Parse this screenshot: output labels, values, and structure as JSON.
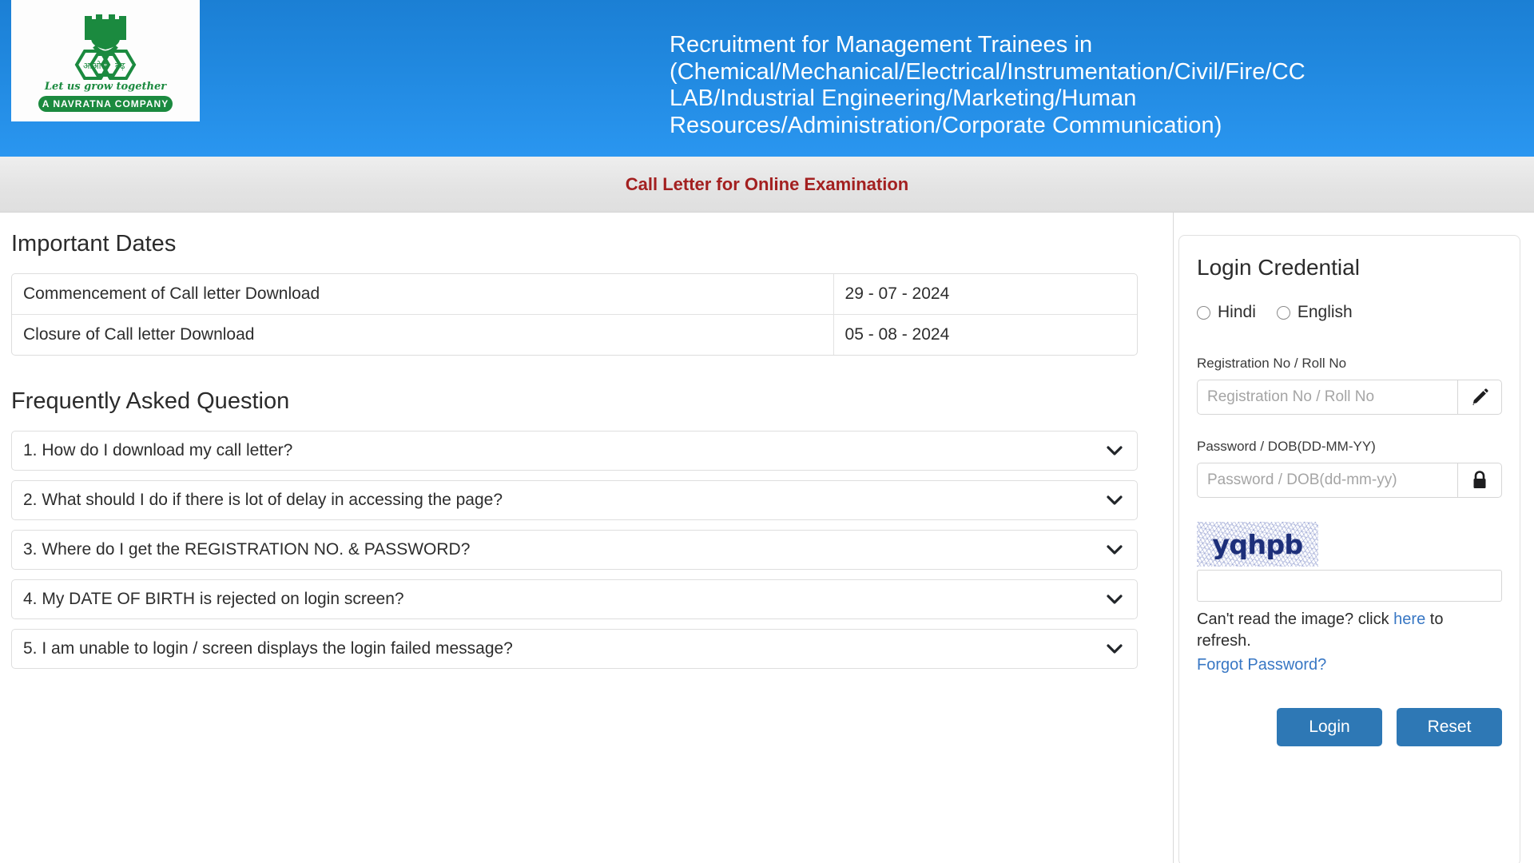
{
  "header": {
    "title": "Recruitment for Management Trainees in (Chemical/Mechanical/Electrical/Instrumentation/Civil/Fire/CC LAB/Industrial Engineering/Marketing/Human Resources/Administration/Corporate Communication)",
    "logo": {
      "hindi_left": "आओ",
      "hindi_center": "मी",
      "hindi_right": "बढ़",
      "tagline": "Let us grow together",
      "badge": "A NAVRATNA COMPANY"
    },
    "subtitle": "Call Letter for Online Examination",
    "colors": {
      "header_gradient_top": "#1b7fd4",
      "header_gradient_bottom": "#2a96f0",
      "subtitle_text": "#a32020",
      "logo_green": "#1b8a3f"
    }
  },
  "important_dates": {
    "heading": "Important Dates",
    "rows": [
      {
        "label": "Commencement of Call letter Download",
        "value": "29 - 07 - 2024"
      },
      {
        "label": "Closure of Call letter Download",
        "value": "05 - 08 - 2024"
      }
    ]
  },
  "faq": {
    "heading": "Frequently Asked Question",
    "items": [
      {
        "question": "1. How do I download my call letter?"
      },
      {
        "question": "2. What should I do if there is lot of delay in accessing the page?"
      },
      {
        "question": "3. Where do I get the REGISTRATION NO. & PASSWORD?"
      },
      {
        "question": "4. My DATE OF BIRTH is rejected on login screen?"
      },
      {
        "question": "5. I am unable to login / screen displays the login failed message?"
      }
    ]
  },
  "login": {
    "title": "Login Credential",
    "language_options": [
      {
        "label": "Hindi",
        "selected": false
      },
      {
        "label": "English",
        "selected": false
      }
    ],
    "registration": {
      "label": "Registration No / Roll No",
      "placeholder": "Registration No / Roll No",
      "value": "",
      "addon_icon": "pencil-icon"
    },
    "password": {
      "label": "Password / DOB(DD-MM-YY)",
      "placeholder": "Password / DOB(dd-mm-yy)",
      "value": "",
      "addon_icon": "lock-icon"
    },
    "captcha": {
      "text": "yqhpb",
      "input_value": "",
      "refresh_prefix": "Can't read the image? click ",
      "refresh_link": "here",
      "refresh_suffix": " to refresh.",
      "forgot_password": "Forgot Password?"
    },
    "buttons": {
      "login": "Login",
      "reset": "Reset"
    },
    "colors": {
      "button_bg": "#2e78b5",
      "link": "#3877c4",
      "captcha_text": "#1d2f7a"
    }
  }
}
